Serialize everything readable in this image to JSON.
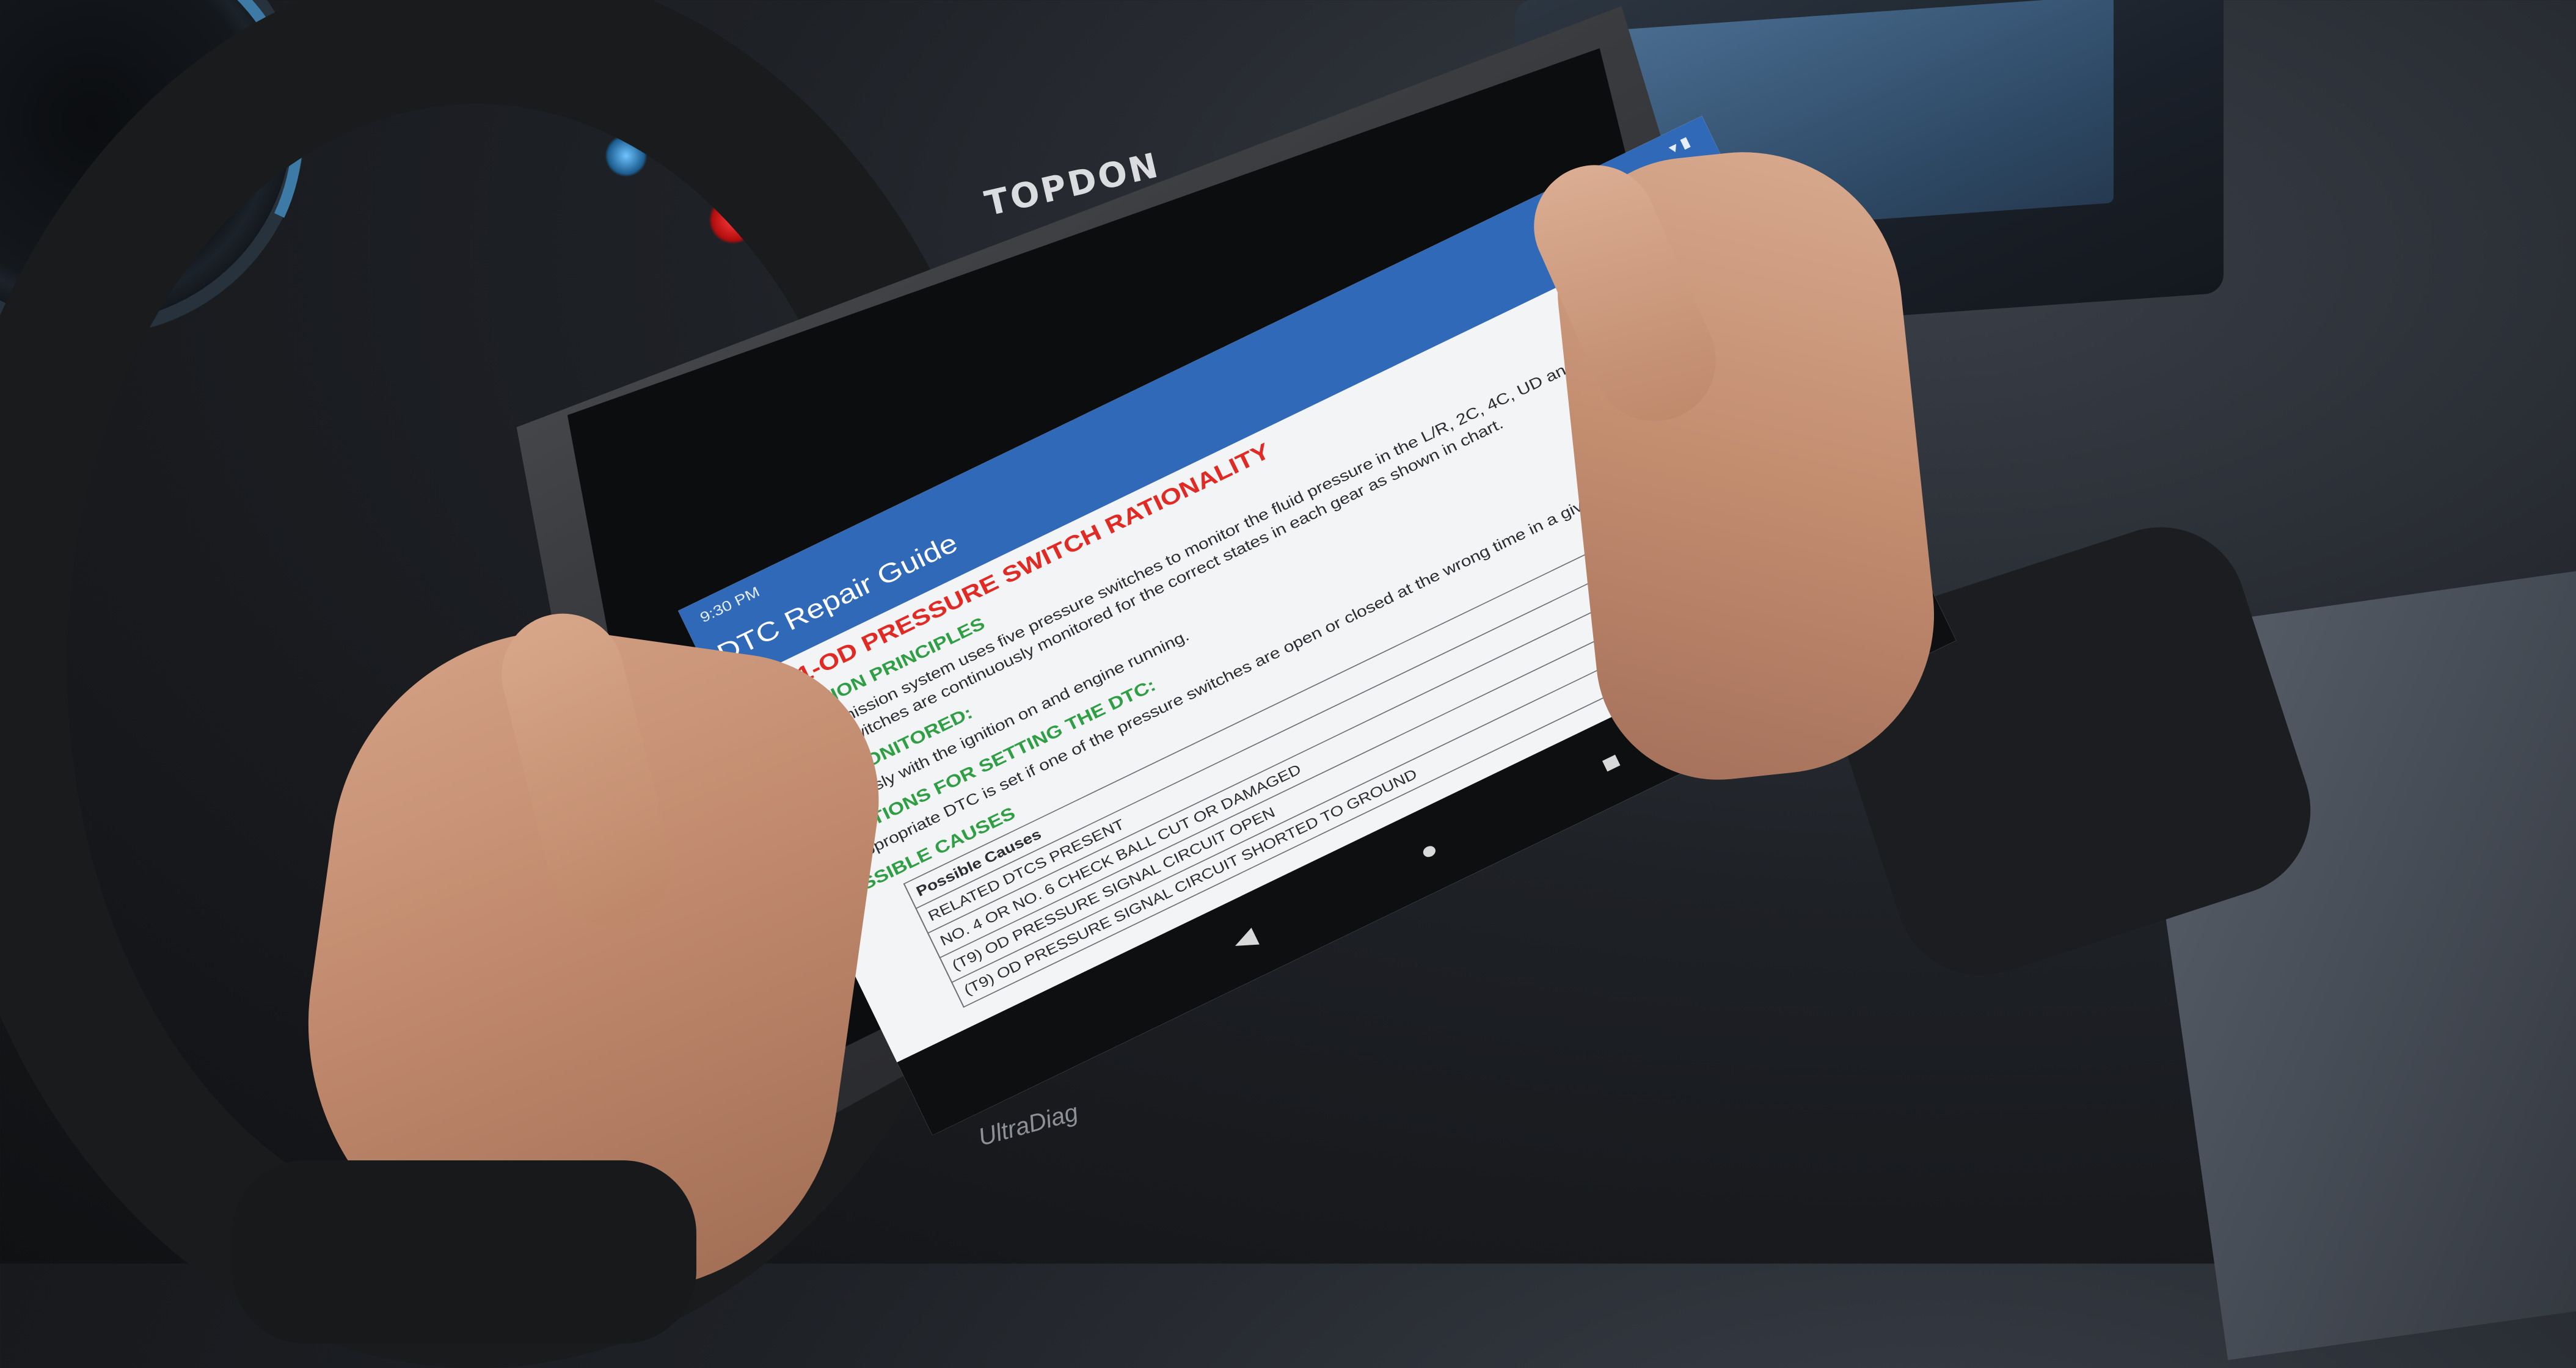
{
  "device": {
    "brand": "TOPDON",
    "model": "UltraDiag"
  },
  "statusbar": {
    "time": "9:30 PM",
    "icons": [
      "wifi-icon",
      "battery-icon"
    ]
  },
  "appbar": {
    "title": "DTC Repair Guide"
  },
  "dtc": {
    "title": "P0871-OD PRESSURE SWITCH RATIONALITY",
    "sections": [
      {
        "heading": "OPERATION PRINCIPLES",
        "text": "The Transmission system uses five pressure switches to monitor the fluid pressure in the L/R, 2C, 4C, UD and OD clutch circuits. The pressure switches are continuously monitored for the correct states in each gear as shown in chart."
      },
      {
        "heading": "WHEN MONITORED:",
        "text": "Continuously with the ignition on and engine running."
      },
      {
        "heading": "CONDITIONS FOR SETTING THE DTC:",
        "text": "The appropriate DTC is set if one of the pressure switches are open or closed at the wrong time in a given gear."
      },
      {
        "heading": "POSSIBLE CAUSES",
        "text": ""
      }
    ],
    "causes_table": {
      "header": "Possible Causes",
      "rows": [
        "RELATED DTCS PRESENT",
        "NO. 4 OR NO. 6 CHECK BALL CUT OR DAMAGED",
        "(T9) OD PRESSURE SIGNAL CIRCUIT OPEN",
        "(T9) OD PRESSURE SIGNAL CIRCUIT SHORTED TO GROUND"
      ]
    }
  },
  "navbar": {
    "back": "◀",
    "home": "●",
    "recents": "■"
  }
}
